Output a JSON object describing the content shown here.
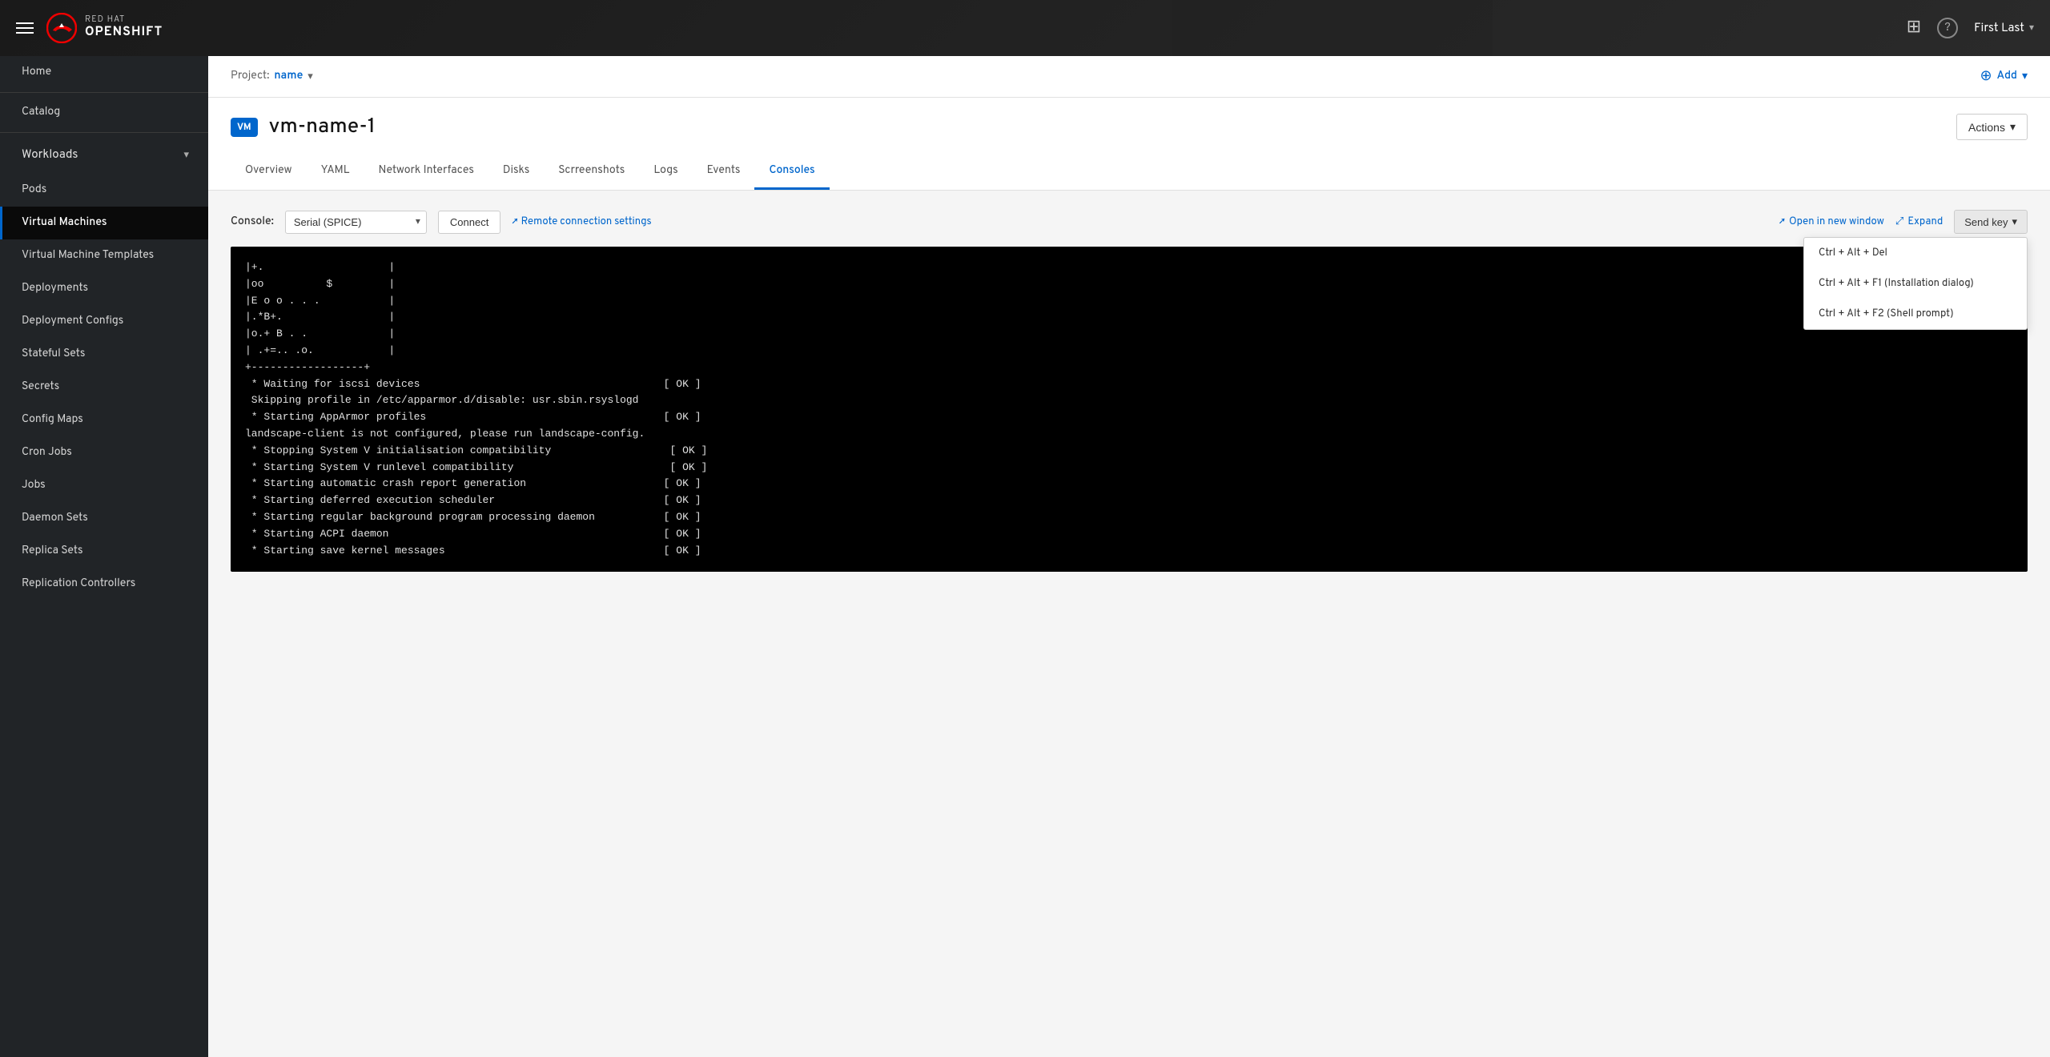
{
  "topnav": {
    "hamburger_label": "Menu",
    "brand_redhat": "RED HAT",
    "brand_openshift": "OPENSHIFT",
    "user": "First Last",
    "grid_icon": "⊞",
    "help_icon": "?",
    "chevron": "▾"
  },
  "sidebar": {
    "items": [
      {
        "id": "home",
        "label": "Home",
        "active": false,
        "section": false
      },
      {
        "id": "catalog",
        "label": "Catalog",
        "active": false,
        "section": false
      },
      {
        "id": "workloads",
        "label": "Workloads",
        "active": false,
        "section": true,
        "expanded": true
      },
      {
        "id": "pods",
        "label": "Pods",
        "active": false,
        "section": false
      },
      {
        "id": "virtual-machines",
        "label": "Virtual Machines",
        "active": true,
        "section": false
      },
      {
        "id": "virtual-machine-templates",
        "label": "Virtual Machine Templates",
        "active": false,
        "section": false
      },
      {
        "id": "deployments",
        "label": "Deployments",
        "active": false,
        "section": false
      },
      {
        "id": "deployment-configs",
        "label": "Deployment Configs",
        "active": false,
        "section": false
      },
      {
        "id": "stateful-sets",
        "label": "Stateful Sets",
        "active": false,
        "section": false
      },
      {
        "id": "secrets",
        "label": "Secrets",
        "active": false,
        "section": false
      },
      {
        "id": "config-maps",
        "label": "Config Maps",
        "active": false,
        "section": false
      },
      {
        "id": "cron-jobs",
        "label": "Cron Jobs",
        "active": false,
        "section": false
      },
      {
        "id": "jobs",
        "label": "Jobs",
        "active": false,
        "section": false
      },
      {
        "id": "daemon-sets",
        "label": "Daemon Sets",
        "active": false,
        "section": false
      },
      {
        "id": "replica-sets",
        "label": "Replica Sets",
        "active": false,
        "section": false
      },
      {
        "id": "replication-controllers",
        "label": "Replication Controllers",
        "active": false,
        "section": false
      }
    ]
  },
  "project": {
    "label": "Project:",
    "name": "name",
    "add_label": "Add"
  },
  "vm": {
    "badge": "VM",
    "name": "vm-name-1",
    "actions_label": "Actions"
  },
  "tabs": [
    {
      "id": "overview",
      "label": "Overview",
      "active": false
    },
    {
      "id": "yaml",
      "label": "YAML",
      "active": false
    },
    {
      "id": "network-interfaces",
      "label": "Network Interfaces",
      "active": false
    },
    {
      "id": "disks",
      "label": "Disks",
      "active": false
    },
    {
      "id": "screenshots",
      "label": "Scrreenshots",
      "active": false
    },
    {
      "id": "logs",
      "label": "Logs",
      "active": false
    },
    {
      "id": "events",
      "label": "Events",
      "active": false
    },
    {
      "id": "consoles",
      "label": "Consoles",
      "active": true
    }
  ],
  "console": {
    "label": "Console:",
    "type": "Serial (SPICE)",
    "connect_label": "Connect",
    "remote_label": "Remote connection settings",
    "open_window_label": "Open in new window",
    "expand_label": "Expand",
    "send_key_label": "Send key",
    "send_key_options": [
      {
        "id": "ctrl-alt-del",
        "label": "Ctrl + Alt + Del"
      },
      {
        "id": "ctrl-alt-f1",
        "label": "Ctrl + Alt + F1 (Installation dialog)"
      },
      {
        "id": "ctrl-alt-f2",
        "label": "Ctrl + Alt + F2 (Shell prompt)"
      }
    ]
  },
  "terminal": {
    "lines": [
      "|+.                    |",
      "|oo          $         |",
      "|E o o . . .           |",
      "|.*B+.                 |",
      "|o.+ B . .             |",
      "| .+=.. .o.            |",
      "+------------------+",
      " * Waiting for iscsi devices                                       [ OK ]",
      " Skipping profile in /etc/apparmor.d/disable: usr.sbin.rsyslogd",
      " * Starting AppArmor profiles                                      [ OK ]",
      "landscape-client is not configured, please run landscape-config.",
      " * Stopping System V initialisation compatibility                   [ OK ]",
      " * Starting System V runlevel compatibility                         [ OK ]",
      " * Starting automatic crash report generation                      [ OK ]",
      " * Starting deferred execution scheduler                           [ OK ]",
      " * Starting regular background program processing daemon           [ OK ]",
      " * Starting ACPI daemon                                            [ OK ]",
      " * Starting save kernel messages                                   [ OK ]"
    ]
  },
  "colors": {
    "brand_blue": "#06c",
    "sidebar_bg": "#212427",
    "active_item_bg": "#0a0a0a",
    "vm_badge_bg": "#06c"
  }
}
